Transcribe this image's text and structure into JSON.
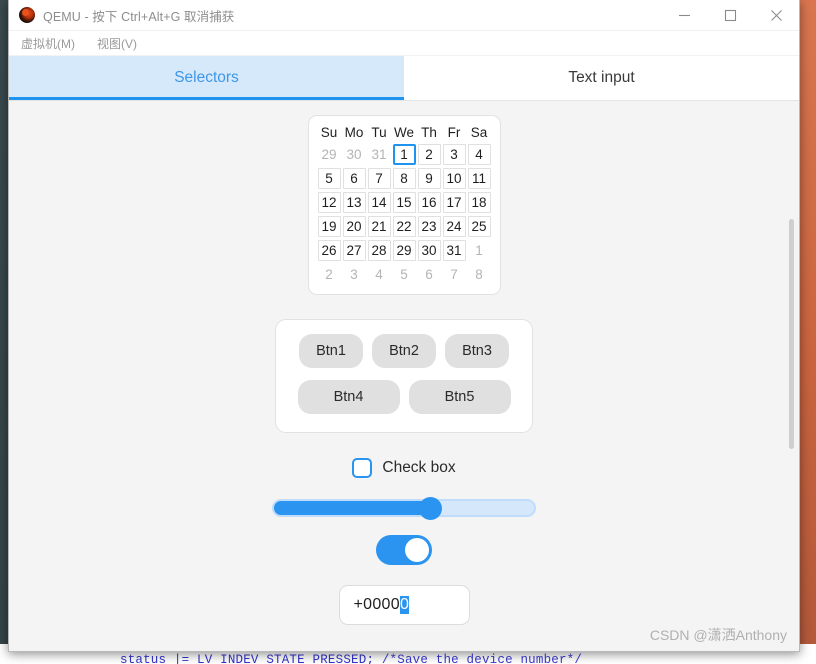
{
  "window": {
    "title": "QEMU - 按下 Ctrl+Alt+G 取消捕获",
    "icon": "qemu-logo-icon",
    "controls": {
      "minimize": "minimize-icon",
      "maximize": "maximize-icon",
      "close": "close-icon"
    }
  },
  "menu": {
    "items": [
      {
        "label": "虚拟机(M)"
      },
      {
        "label": "视图(V)"
      }
    ]
  },
  "tabs": [
    {
      "label": "Selectors",
      "active": true
    },
    {
      "label": "Text input",
      "active": false
    }
  ],
  "calendar": {
    "weekdays": [
      "Su",
      "Mo",
      "Tu",
      "We",
      "Th",
      "Fr",
      "Sa"
    ],
    "weeks": [
      [
        {
          "day": "29",
          "state": "out"
        },
        {
          "day": "30",
          "state": "out"
        },
        {
          "day": "31",
          "state": "out"
        },
        {
          "day": "1",
          "state": "selected"
        },
        {
          "day": "2",
          "state": "in"
        },
        {
          "day": "3",
          "state": "in"
        },
        {
          "day": "4",
          "state": "in"
        }
      ],
      [
        {
          "day": "5",
          "state": "in"
        },
        {
          "day": "6",
          "state": "in"
        },
        {
          "day": "7",
          "state": "in"
        },
        {
          "day": "8",
          "state": "in"
        },
        {
          "day": "9",
          "state": "in"
        },
        {
          "day": "10",
          "state": "in"
        },
        {
          "day": "11",
          "state": "in"
        }
      ],
      [
        {
          "day": "12",
          "state": "in"
        },
        {
          "day": "13",
          "state": "in"
        },
        {
          "day": "14",
          "state": "in"
        },
        {
          "day": "15",
          "state": "in"
        },
        {
          "day": "16",
          "state": "in"
        },
        {
          "day": "17",
          "state": "in"
        },
        {
          "day": "18",
          "state": "in"
        }
      ],
      [
        {
          "day": "19",
          "state": "in"
        },
        {
          "day": "20",
          "state": "in"
        },
        {
          "day": "21",
          "state": "in"
        },
        {
          "day": "22",
          "state": "in"
        },
        {
          "day": "23",
          "state": "in"
        },
        {
          "day": "24",
          "state": "in"
        },
        {
          "day": "25",
          "state": "in"
        }
      ],
      [
        {
          "day": "26",
          "state": "in"
        },
        {
          "day": "27",
          "state": "in"
        },
        {
          "day": "28",
          "state": "in"
        },
        {
          "day": "29",
          "state": "in"
        },
        {
          "day": "30",
          "state": "in"
        },
        {
          "day": "31",
          "state": "in"
        },
        {
          "day": "1",
          "state": "out"
        }
      ],
      [
        {
          "day": "2",
          "state": "out"
        },
        {
          "day": "3",
          "state": "out"
        },
        {
          "day": "4",
          "state": "out"
        },
        {
          "day": "5",
          "state": "out"
        },
        {
          "day": "6",
          "state": "out"
        },
        {
          "day": "7",
          "state": "out"
        },
        {
          "day": "8",
          "state": "out"
        }
      ]
    ]
  },
  "buttons": {
    "row1": [
      {
        "label": "Btn1"
      },
      {
        "label": "Btn2"
      },
      {
        "label": "Btn3"
      }
    ],
    "row2": [
      {
        "label": "Btn4"
      },
      {
        "label": "Btn5"
      }
    ]
  },
  "checkbox": {
    "label": "Check box",
    "checked": false
  },
  "slider": {
    "value_percent": 60,
    "min": 0,
    "max": 100
  },
  "toggle": {
    "state": "on"
  },
  "text_input": {
    "value_prefix": "+0000",
    "value_selected": "0",
    "full_value": "+00000",
    "placeholder": ""
  },
  "watermark": {
    "text": "CSDN @潇洒Anthony"
  },
  "backdrop": {
    "code_prefix": "status |= LV_INDEV_STATE_PRESSED;",
    "code_comment": "/*Save the device number*/"
  },
  "colors": {
    "accent": "#2b93f0",
    "tab_active_bg": "#d6e9fb",
    "button_bg": "#e0e0e0",
    "content_bg": "#f4f4f4",
    "title_text": "#8d8d8d"
  }
}
